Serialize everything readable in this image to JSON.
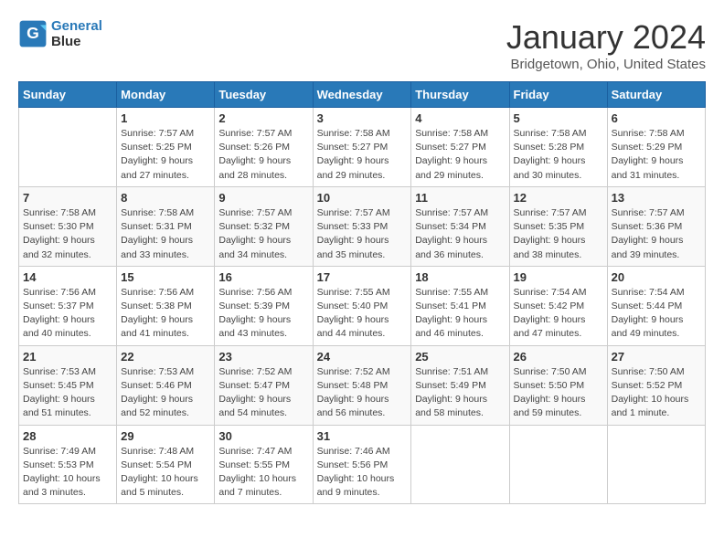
{
  "header": {
    "logo_line1": "General",
    "logo_line2": "Blue",
    "month": "January 2024",
    "location": "Bridgetown, Ohio, United States"
  },
  "weekdays": [
    "Sunday",
    "Monday",
    "Tuesday",
    "Wednesday",
    "Thursday",
    "Friday",
    "Saturday"
  ],
  "weeks": [
    [
      {
        "day": "",
        "info": ""
      },
      {
        "day": "1",
        "info": "Sunrise: 7:57 AM\nSunset: 5:25 PM\nDaylight: 9 hours\nand 27 minutes."
      },
      {
        "day": "2",
        "info": "Sunrise: 7:57 AM\nSunset: 5:26 PM\nDaylight: 9 hours\nand 28 minutes."
      },
      {
        "day": "3",
        "info": "Sunrise: 7:58 AM\nSunset: 5:27 PM\nDaylight: 9 hours\nand 29 minutes."
      },
      {
        "day": "4",
        "info": "Sunrise: 7:58 AM\nSunset: 5:27 PM\nDaylight: 9 hours\nand 29 minutes."
      },
      {
        "day": "5",
        "info": "Sunrise: 7:58 AM\nSunset: 5:28 PM\nDaylight: 9 hours\nand 30 minutes."
      },
      {
        "day": "6",
        "info": "Sunrise: 7:58 AM\nSunset: 5:29 PM\nDaylight: 9 hours\nand 31 minutes."
      }
    ],
    [
      {
        "day": "7",
        "info": "Sunrise: 7:58 AM\nSunset: 5:30 PM\nDaylight: 9 hours\nand 32 minutes."
      },
      {
        "day": "8",
        "info": "Sunrise: 7:58 AM\nSunset: 5:31 PM\nDaylight: 9 hours\nand 33 minutes."
      },
      {
        "day": "9",
        "info": "Sunrise: 7:57 AM\nSunset: 5:32 PM\nDaylight: 9 hours\nand 34 minutes."
      },
      {
        "day": "10",
        "info": "Sunrise: 7:57 AM\nSunset: 5:33 PM\nDaylight: 9 hours\nand 35 minutes."
      },
      {
        "day": "11",
        "info": "Sunrise: 7:57 AM\nSunset: 5:34 PM\nDaylight: 9 hours\nand 36 minutes."
      },
      {
        "day": "12",
        "info": "Sunrise: 7:57 AM\nSunset: 5:35 PM\nDaylight: 9 hours\nand 38 minutes."
      },
      {
        "day": "13",
        "info": "Sunrise: 7:57 AM\nSunset: 5:36 PM\nDaylight: 9 hours\nand 39 minutes."
      }
    ],
    [
      {
        "day": "14",
        "info": "Sunrise: 7:56 AM\nSunset: 5:37 PM\nDaylight: 9 hours\nand 40 minutes."
      },
      {
        "day": "15",
        "info": "Sunrise: 7:56 AM\nSunset: 5:38 PM\nDaylight: 9 hours\nand 41 minutes."
      },
      {
        "day": "16",
        "info": "Sunrise: 7:56 AM\nSunset: 5:39 PM\nDaylight: 9 hours\nand 43 minutes."
      },
      {
        "day": "17",
        "info": "Sunrise: 7:55 AM\nSunset: 5:40 PM\nDaylight: 9 hours\nand 44 minutes."
      },
      {
        "day": "18",
        "info": "Sunrise: 7:55 AM\nSunset: 5:41 PM\nDaylight: 9 hours\nand 46 minutes."
      },
      {
        "day": "19",
        "info": "Sunrise: 7:54 AM\nSunset: 5:42 PM\nDaylight: 9 hours\nand 47 minutes."
      },
      {
        "day": "20",
        "info": "Sunrise: 7:54 AM\nSunset: 5:44 PM\nDaylight: 9 hours\nand 49 minutes."
      }
    ],
    [
      {
        "day": "21",
        "info": "Sunrise: 7:53 AM\nSunset: 5:45 PM\nDaylight: 9 hours\nand 51 minutes."
      },
      {
        "day": "22",
        "info": "Sunrise: 7:53 AM\nSunset: 5:46 PM\nDaylight: 9 hours\nand 52 minutes."
      },
      {
        "day": "23",
        "info": "Sunrise: 7:52 AM\nSunset: 5:47 PM\nDaylight: 9 hours\nand 54 minutes."
      },
      {
        "day": "24",
        "info": "Sunrise: 7:52 AM\nSunset: 5:48 PM\nDaylight: 9 hours\nand 56 minutes."
      },
      {
        "day": "25",
        "info": "Sunrise: 7:51 AM\nSunset: 5:49 PM\nDaylight: 9 hours\nand 58 minutes."
      },
      {
        "day": "26",
        "info": "Sunrise: 7:50 AM\nSunset: 5:50 PM\nDaylight: 9 hours\nand 59 minutes."
      },
      {
        "day": "27",
        "info": "Sunrise: 7:50 AM\nSunset: 5:52 PM\nDaylight: 10 hours\nand 1 minute."
      }
    ],
    [
      {
        "day": "28",
        "info": "Sunrise: 7:49 AM\nSunset: 5:53 PM\nDaylight: 10 hours\nand 3 minutes."
      },
      {
        "day": "29",
        "info": "Sunrise: 7:48 AM\nSunset: 5:54 PM\nDaylight: 10 hours\nand 5 minutes."
      },
      {
        "day": "30",
        "info": "Sunrise: 7:47 AM\nSunset: 5:55 PM\nDaylight: 10 hours\nand 7 minutes."
      },
      {
        "day": "31",
        "info": "Sunrise: 7:46 AM\nSunset: 5:56 PM\nDaylight: 10 hours\nand 9 minutes."
      },
      {
        "day": "",
        "info": ""
      },
      {
        "day": "",
        "info": ""
      },
      {
        "day": "",
        "info": ""
      }
    ]
  ]
}
